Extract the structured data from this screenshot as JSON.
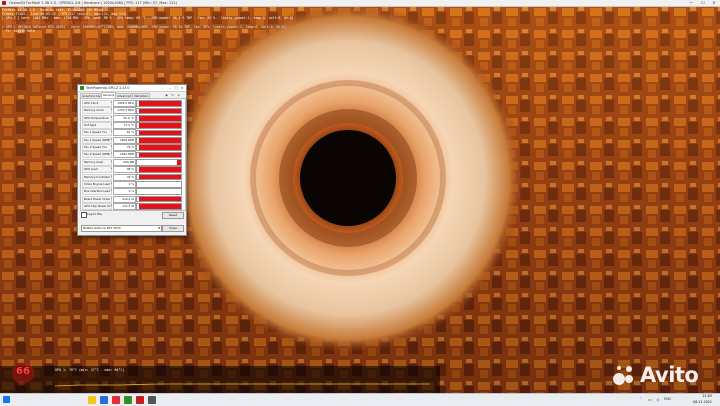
{
  "window": {
    "title": "Ozone3D FurMark 1.38.1.0 - OPENGL 4.6 | Hardcore | 1920x1080 | FPS: 117 (Min: 57, Max: 122)",
    "minimize": "—",
    "maximize": "☐",
    "close": "✕"
  },
  "osd": {
    "line1": "FurMark v1.38.1.0 - Burn-in test, 1920x1080 (0X MSAA)",
    "line2": "Frames:37485 - time:00:05:32 - FPS:117 (min:57, max:122, avg:113)",
    "line3": "[ GPU-Z ] core: 1903 MHz - mem: 1750 MHz - GPU load: 98 % - GPU temp: 65 °C - GPU power: 98.3 % TDP - fan: 82 % - limits:[power:1, temp:0, volt:0, OV:0]",
    "line4": "> OpenGL renderer: NVIDIA GeForce RTX 3070/PCIe/SSE2",
    "line5": "> GPU 1 (NVIDIA GeForce RTX 3070) - core: 1905MHz/67°C/98%, mem: 7000MHz/80%, GPU power: 98.3% TDP, fan: 82%, limits:[power:1, temp:0, volt:0, OV:0]",
    "line6": "- F1: toggle help"
  },
  "gpuz": {
    "title": "TechPowerUp GPU-Z 2.43.0",
    "tabs": [
      "Graphics Card",
      "Sensors",
      "Advanced",
      "Validation"
    ],
    "active_tab": "Sensors",
    "sensors": [
      {
        "name": "GPU Clock",
        "value": "1905.0 MHz",
        "fill": 0.95
      },
      {
        "name": "Memory Clock",
        "value": "1750.2 MHz",
        "fill": 0.95
      },
      {
        "name": "GPU Temperature",
        "value": "65.0 °C",
        "fill": 0.95
      },
      {
        "name": "Hot Spot",
        "value": "71.4 °C",
        "fill": 0.95
      },
      {
        "name": "Fan 1 Speed (%)",
        "value": "81 %",
        "fill": 0.95
      },
      {
        "name": "Fan 1 Speed (RPM)",
        "value": "1608 RPM",
        "fill": 0.95
      },
      {
        "name": "Fan 2 Speed (%)",
        "value": "79 %",
        "fill": 0.95
      },
      {
        "name": "Fan 2 Speed (RPM)",
        "value": "1650 RPM",
        "fill": 0.95
      },
      {
        "name": "Memory Used",
        "value": "690 MB",
        "fill": 0.1
      },
      {
        "name": "GPU Load",
        "value": "98 %",
        "fill": 0.95
      },
      {
        "name": "Memory Controller Load",
        "value": "39 %",
        "fill": 0.95
      },
      {
        "name": "Video Engine Load",
        "value": "0 %",
        "fill": 0.0
      },
      {
        "name": "Bus Interface Load",
        "value": "0 %",
        "fill": 0.0
      },
      {
        "name": "Board Power Draw",
        "value": "216.4 W",
        "fill": 0.95
      },
      {
        "name": "GPU Chip Power Draw",
        "value": "111.3 W",
        "fill": 0.95
      }
    ],
    "log_label": "Log to file",
    "reset_label": "Reset",
    "gpu_select": "NVIDIA GeForce RTX 3070",
    "close_label": "Close"
  },
  "graph": {
    "label": "GPU 1: 70°C (min: 37°C - max: 66°C)"
  },
  "badge": {
    "text": "66"
  },
  "watermark": {
    "text": "Avito"
  },
  "taskbar": {
    "time": "21:03",
    "date": "08.11.2021",
    "lang": "ENG"
  },
  "colors": {
    "sensor_bar": "#e3121b",
    "taskbar": "#e9ecf1"
  }
}
